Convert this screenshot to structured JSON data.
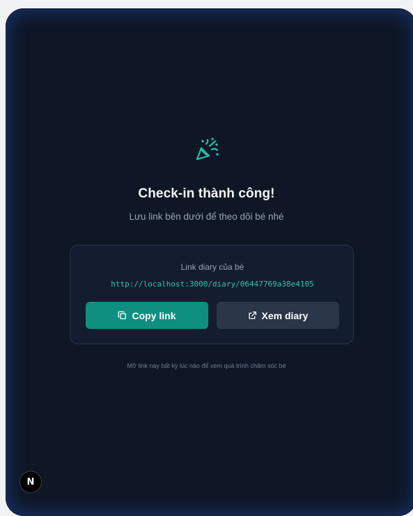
{
  "success": {
    "icon": "party-popper-icon",
    "title": "Check-in thành công!",
    "subtitle": "Lưu link bên dưới để theo dõi bé nhé"
  },
  "card": {
    "label": "Link diary của bé",
    "url": "http://localhost:3000/diary/06447769a38e4105",
    "copy_button": {
      "label": "Copy link",
      "icon": "copy-icon"
    },
    "view_button": {
      "label": "Xem diary",
      "icon": "external-link-icon"
    }
  },
  "footnote": "Mở link này bất kỳ lúc nào để xem quá trình chăm sóc bé",
  "dev_badge": {
    "label": "N",
    "icon": "nextjs-logo-icon"
  },
  "colors": {
    "background": "#0f1727",
    "accent": "#0e8f7f",
    "url_text": "#2fc2ae",
    "secondary_button": "#2b3649"
  }
}
